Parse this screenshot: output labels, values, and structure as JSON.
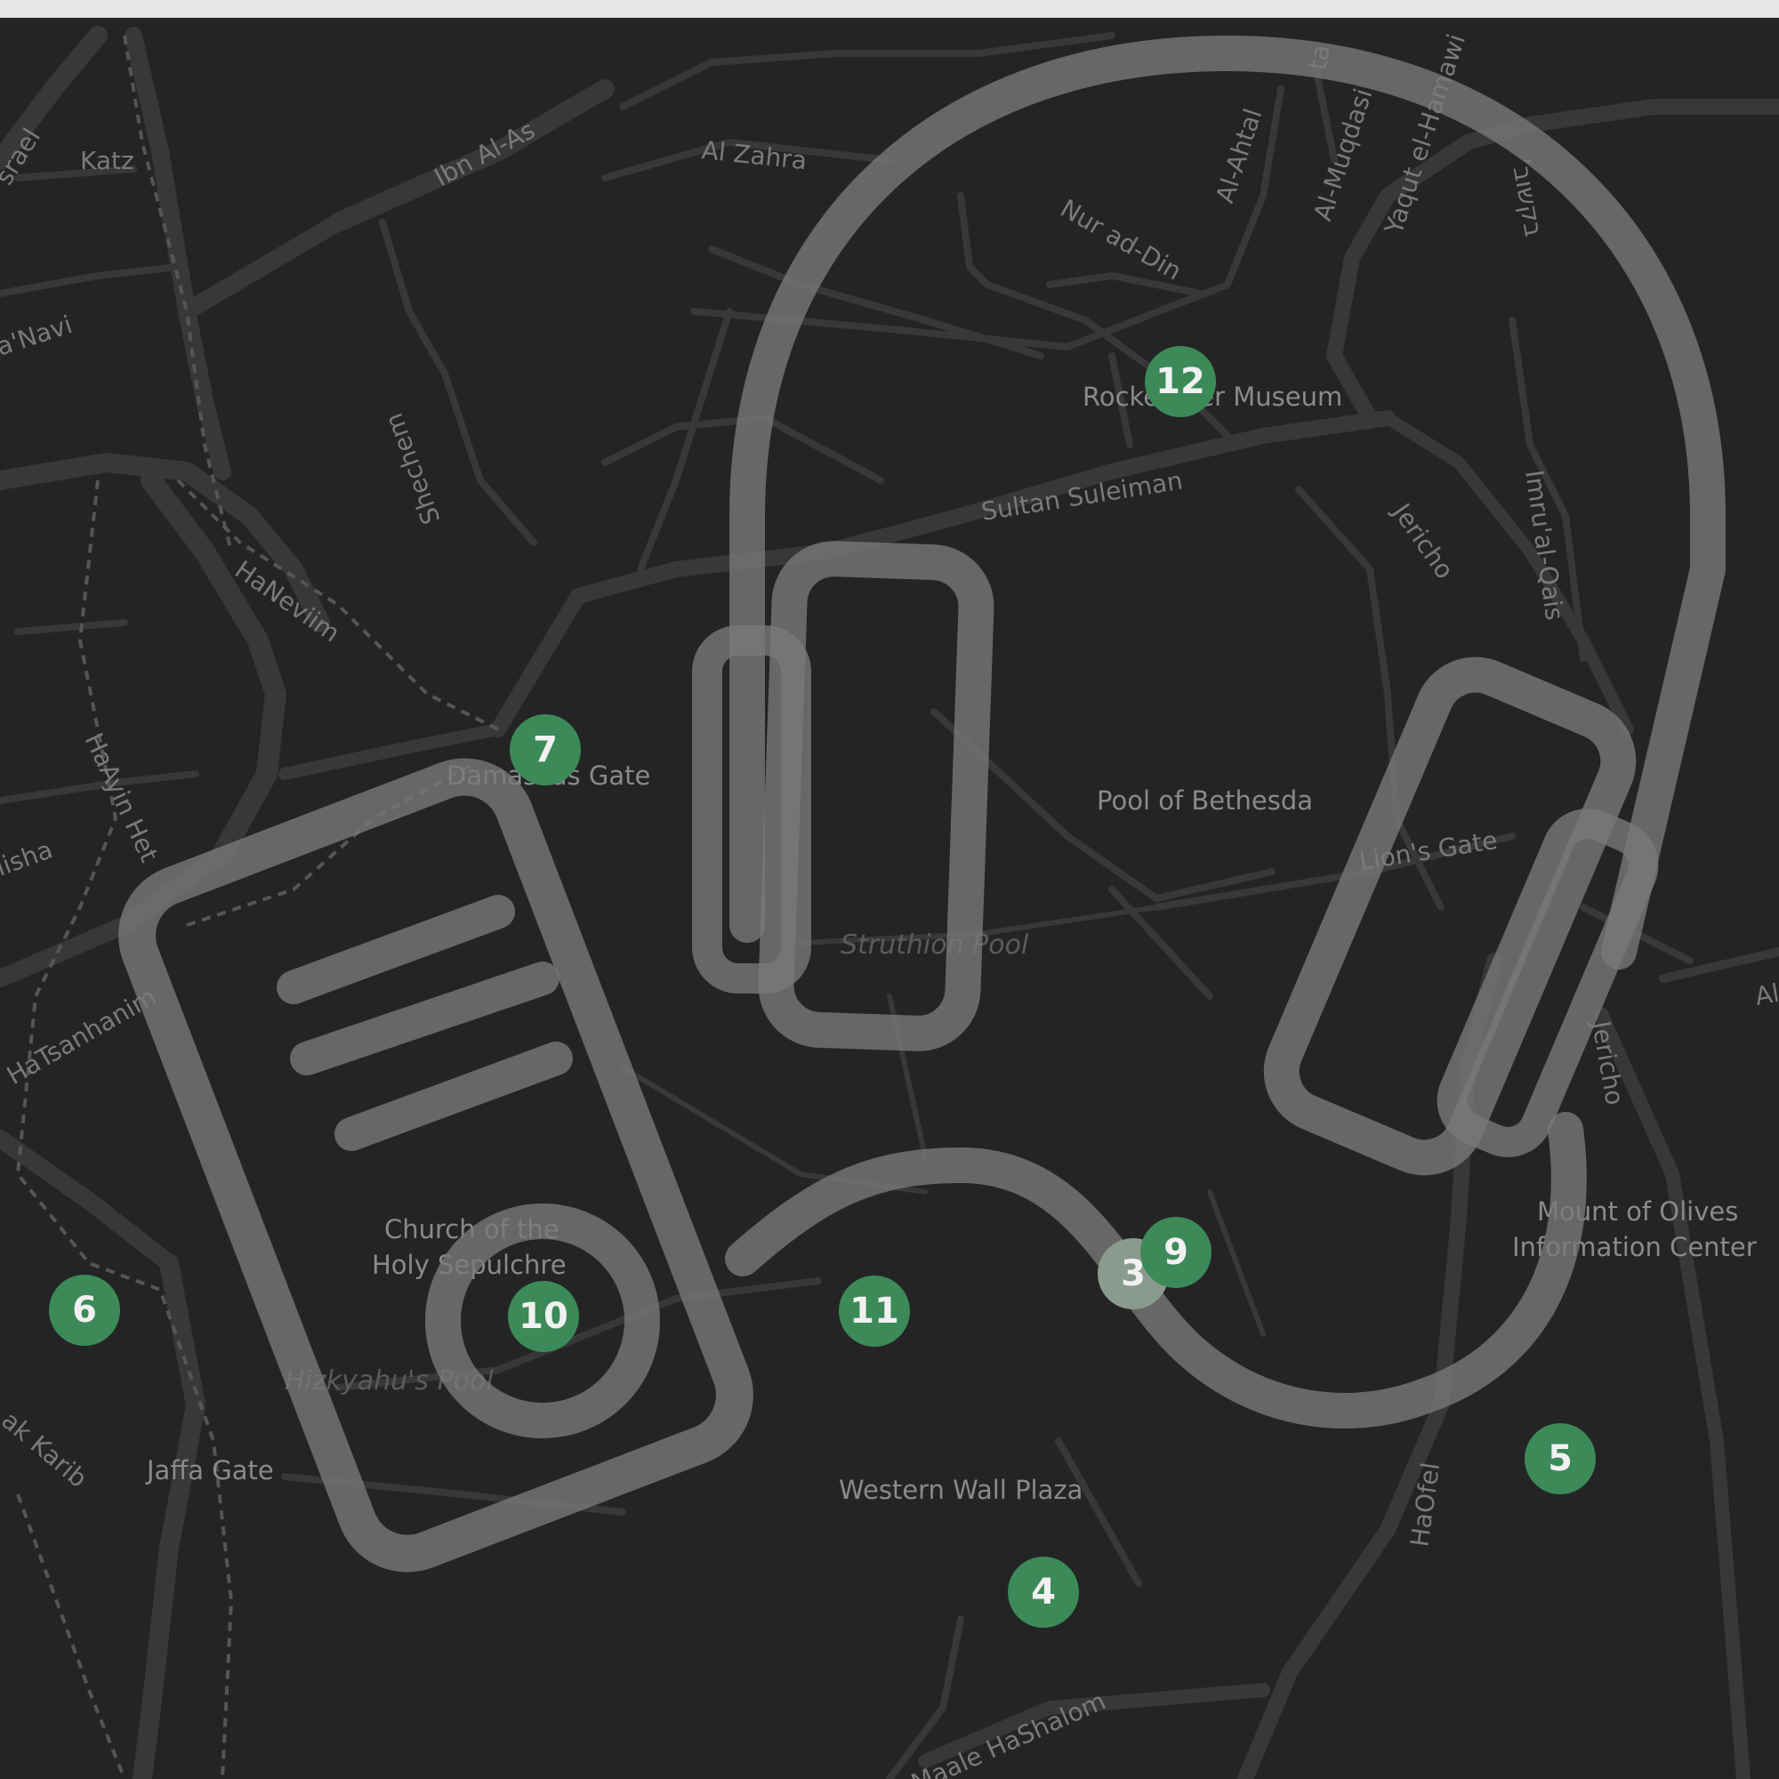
{
  "map": {
    "colors": {
      "background": "#242424",
      "road": "#3d3d3d",
      "marker": "#3b8a58",
      "overlay": "#6e6e6e"
    },
    "overlay_icon": "headphones-audio-guide-icon",
    "streets": {
      "israel": "srael",
      "katz": "Katz",
      "ibn_al_as": "Ibn Al-As",
      "al_zahra": "Al Zahra",
      "nur_ad_din": "Nur ad-Din",
      "al_ahtal": "Al-Ahtal",
      "al_muqdasi": "Al-Muqdasi",
      "yaqut": "Yaqut el-Hamawi",
      "hebrew": "ʼבקשוב",
      "navi": "a'Navi",
      "shechem": "Shechem",
      "haneviim": "HaNeviim",
      "sultan_suleiman": "Sultan Suleiman",
      "jericho_north": "Jericho",
      "imru": "Imru'al-Qais",
      "hayin_het": "HaAyin Het",
      "elisha": "lisha",
      "hatsanhanim": "HaTsanhanim",
      "lions_gate": "Lion's Gate",
      "jericho_east": "Jericho",
      "al_east": "Al",
      "yitzhak_karib": "ak Karib",
      "haofel": "HaOfel",
      "maale_hashalom": "Maale HaShalom",
      "ta": "ta"
    },
    "places": {
      "rockefeller": "Rockefeller Museum",
      "damascus_gate": "Damascus Gate",
      "pool_bethesda": "Pool of Bethesda",
      "church_line1": "Church of the",
      "church_line2": "Holy Sepulchre",
      "jaffa_gate": "Jaffa Gate",
      "western_wall": "Western Wall Plaza",
      "olives_line1": "Mount of Olives",
      "olives_line2": "Information Center"
    },
    "water": {
      "struthion": "Struthion Pool",
      "hizkyahu": "Hizkyahu's Pool"
    },
    "markers": [
      "12",
      "7",
      "10",
      "11",
      "3",
      "9",
      "6",
      "5",
      "4"
    ]
  }
}
